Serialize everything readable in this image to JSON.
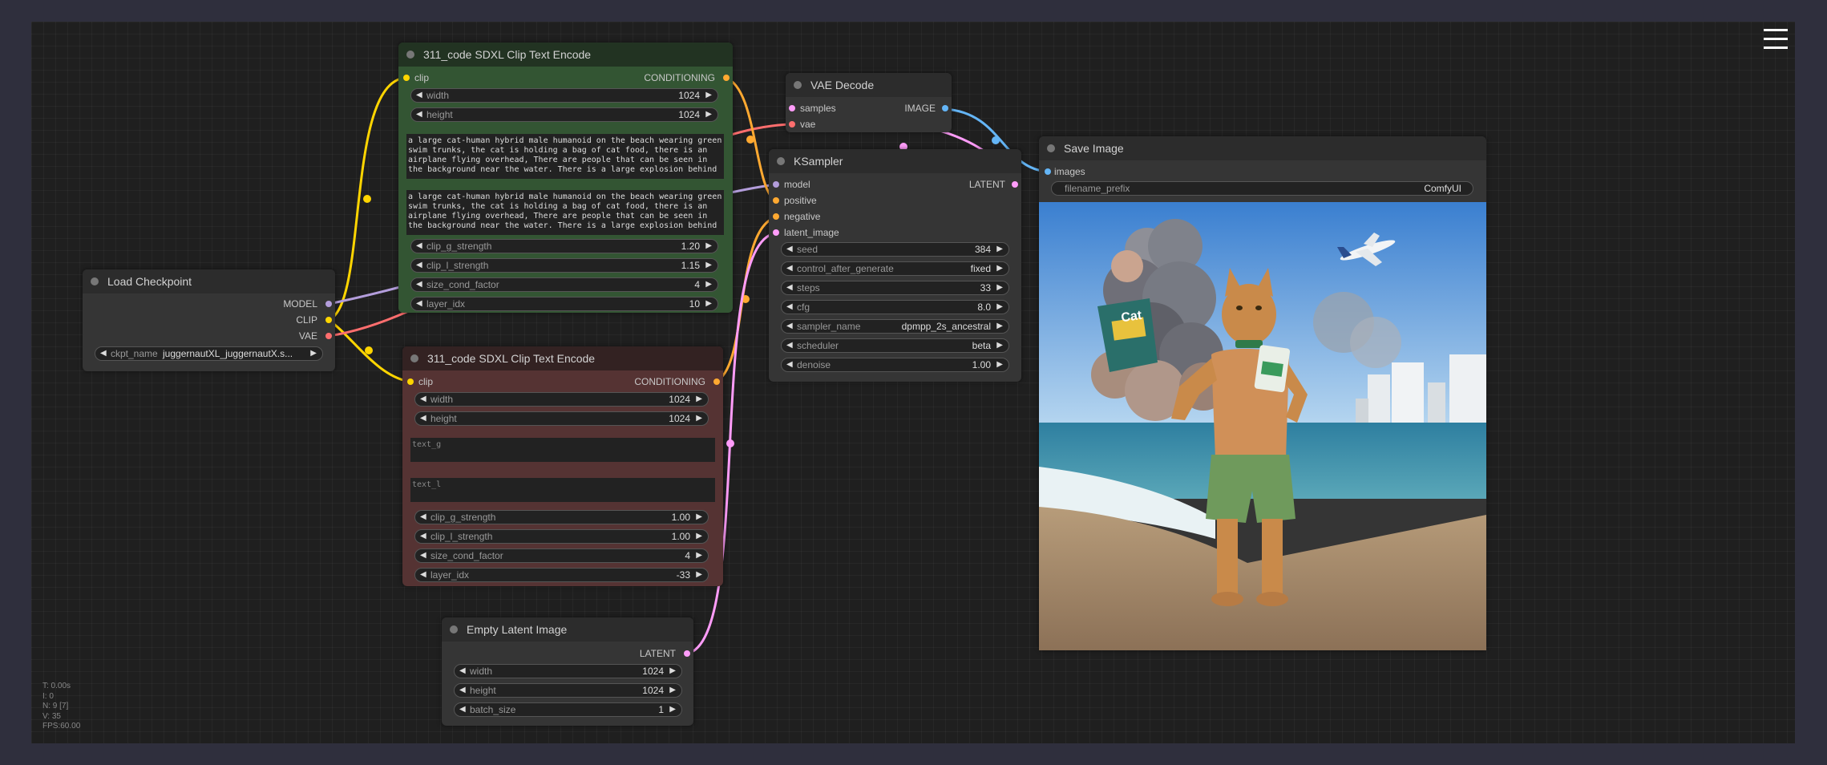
{
  "colors": {
    "canvas_bg": "#1f1f1f",
    "clip_wire": "#ffd500",
    "model_wire": "#b39ddb",
    "vae_wire": "#ff6e6e",
    "conditioning_wire": "#ffa931",
    "latent_wire": "#ff9cf9",
    "image_wire": "#64b5f6"
  },
  "stats": {
    "t": "T: 0.00s",
    "i": "I: 0",
    "n": "N: 9 [7]",
    "v": "V: 35",
    "fps": "FPS:60.00"
  },
  "nodes": {
    "load_checkpoint": {
      "title": "Load Checkpoint",
      "outputs": [
        "MODEL",
        "CLIP",
        "VAE"
      ],
      "widgets": {
        "ckpt_name": {
          "label": "ckpt_name",
          "value": "juggernautXL_juggernautX.s..."
        }
      }
    },
    "clip_encode_pos": {
      "title": "311_code SDXL Clip Text Encode",
      "input": "clip",
      "output": "CONDITIONING",
      "widgets": [
        {
          "label": "width",
          "value": "1024"
        },
        {
          "label": "height",
          "value": "1024"
        }
      ],
      "text_g": "a large cat-human hybrid male humanoid on the beach wearing green swim trunks, the cat is holding a bag of cat food, there is an airplane flying overhead, There are people that can be seen in the background near the water. There is a large explosion behind",
      "text_l": "a large cat-human hybrid male humanoid on the beach wearing green swim trunks, the cat is holding a bag of cat food, there is an airplane flying overhead, There are people that can be seen in the background near the water. There is a large explosion behind",
      "widgets2": [
        {
          "label": "clip_g_strength",
          "value": "1.20"
        },
        {
          "label": "clip_l_strength",
          "value": "1.15"
        },
        {
          "label": "size_cond_factor",
          "value": "4"
        },
        {
          "label": "layer_idx",
          "value": "10"
        }
      ]
    },
    "clip_encode_neg": {
      "title": "311_code SDXL Clip Text Encode",
      "input": "clip",
      "output": "CONDITIONING",
      "widgets": [
        {
          "label": "width",
          "value": "1024"
        },
        {
          "label": "height",
          "value": "1024"
        }
      ],
      "text_g_placeholder": "text_g",
      "text_l_placeholder": "text_l",
      "widgets2": [
        {
          "label": "clip_g_strength",
          "value": "1.00"
        },
        {
          "label": "clip_l_strength",
          "value": "1.00"
        },
        {
          "label": "size_cond_factor",
          "value": "4"
        },
        {
          "label": "layer_idx",
          "value": "-33"
        }
      ]
    },
    "empty_latent": {
      "title": "Empty Latent Image",
      "output": "LATENT",
      "widgets": [
        {
          "label": "width",
          "value": "1024"
        },
        {
          "label": "height",
          "value": "1024"
        },
        {
          "label": "batch_size",
          "value": "1"
        }
      ]
    },
    "vae_decode": {
      "title": "VAE Decode",
      "inputs": [
        "samples",
        "vae"
      ],
      "output": "IMAGE"
    },
    "ksampler": {
      "title": "KSampler",
      "inputs": [
        "model",
        "positive",
        "negative",
        "latent_image"
      ],
      "output": "LATENT",
      "widgets": [
        {
          "label": "seed",
          "value": "384"
        },
        {
          "label": "control_after_generate",
          "value": "fixed"
        },
        {
          "label": "steps",
          "value": "33"
        },
        {
          "label": "cfg",
          "value": "8.0"
        },
        {
          "label": "sampler_name",
          "value": "dpmpp_2s_ancestral"
        },
        {
          "label": "scheduler",
          "value": "beta"
        },
        {
          "label": "denoise",
          "value": "1.00"
        }
      ]
    },
    "save_image": {
      "title": "Save Image",
      "input": "images",
      "widgets": {
        "filename_prefix": {
          "label": "filename_prefix",
          "value": "ComfyUI"
        }
      },
      "preview_bag_text": "Cat"
    }
  }
}
